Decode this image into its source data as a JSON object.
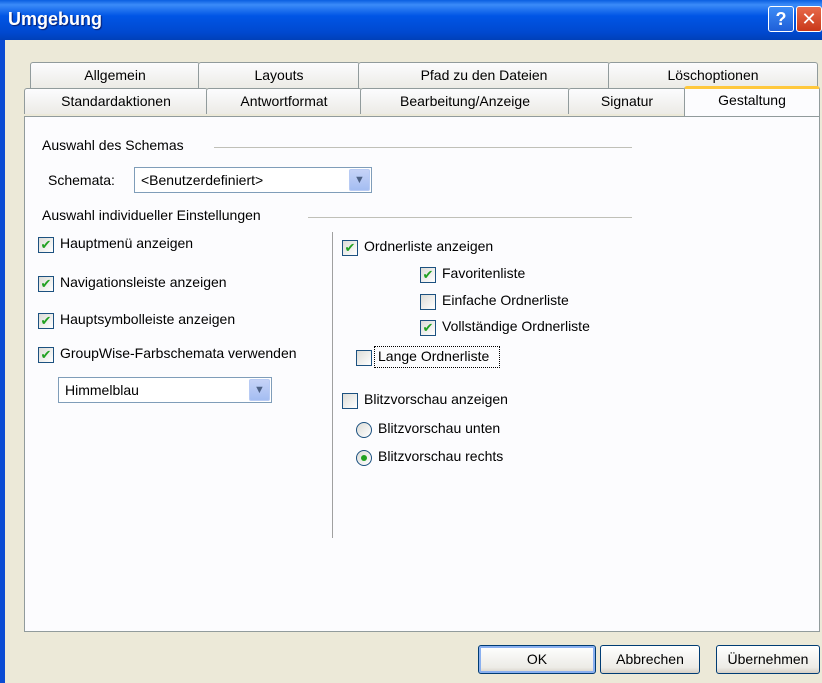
{
  "window": {
    "title": "Umgebung",
    "help_label": "?",
    "close_label": "✕"
  },
  "tabs_row1": [
    "Allgemein",
    "Layouts",
    "Pfad zu den Dateien",
    "Löschoptionen"
  ],
  "tabs_row2": [
    "Standardaktionen",
    "Antwortformat",
    "Bearbeitung/Anzeige",
    "Signatur",
    "Gestaltung"
  ],
  "active_tab": "Gestaltung",
  "schema": {
    "group_label": "Auswahl des Schemas",
    "field_label": "Schemata:",
    "selected": "<Benutzerdefiniert>"
  },
  "individual": {
    "group_label": "Auswahl individueller Einstellungen"
  },
  "left_options": [
    {
      "label": "Hauptmenü anzeigen",
      "checked": true
    },
    {
      "label": "Navigationsleiste anzeigen",
      "checked": true
    },
    {
      "label": "Hauptsymbolleiste anzeigen",
      "checked": true
    },
    {
      "label": "GroupWise-Farbschemata verwenden",
      "checked": true
    }
  ],
  "color_scheme": {
    "selected": "Himmelblau"
  },
  "folder_list": {
    "label": "Ordnerliste anzeigen",
    "checked": true,
    "sub": [
      {
        "label": "Favoritenliste",
        "checked": true
      },
      {
        "label": "Einfache Ordnerliste",
        "checked": false
      },
      {
        "label": "Vollständige Ordnerliste",
        "checked": true
      }
    ],
    "long": {
      "label": "Lange Ordnerliste",
      "checked": false
    }
  },
  "quick_view": {
    "label": "Blitzvorschau anzeigen",
    "checked": false,
    "options": [
      {
        "label": "Blitzvorschau unten",
        "selected": false
      },
      {
        "label": "Blitzvorschau rechts",
        "selected": true
      }
    ]
  },
  "buttons": {
    "ok": "OK",
    "cancel": "Abbrechen",
    "apply": "Übernehmen"
  },
  "icons": {
    "check": "✔",
    "dropdown": "▼"
  },
  "colors": {
    "titlebar": "#0055e5",
    "active_tab_accent": "#ffc83c",
    "check": "#21a121"
  }
}
